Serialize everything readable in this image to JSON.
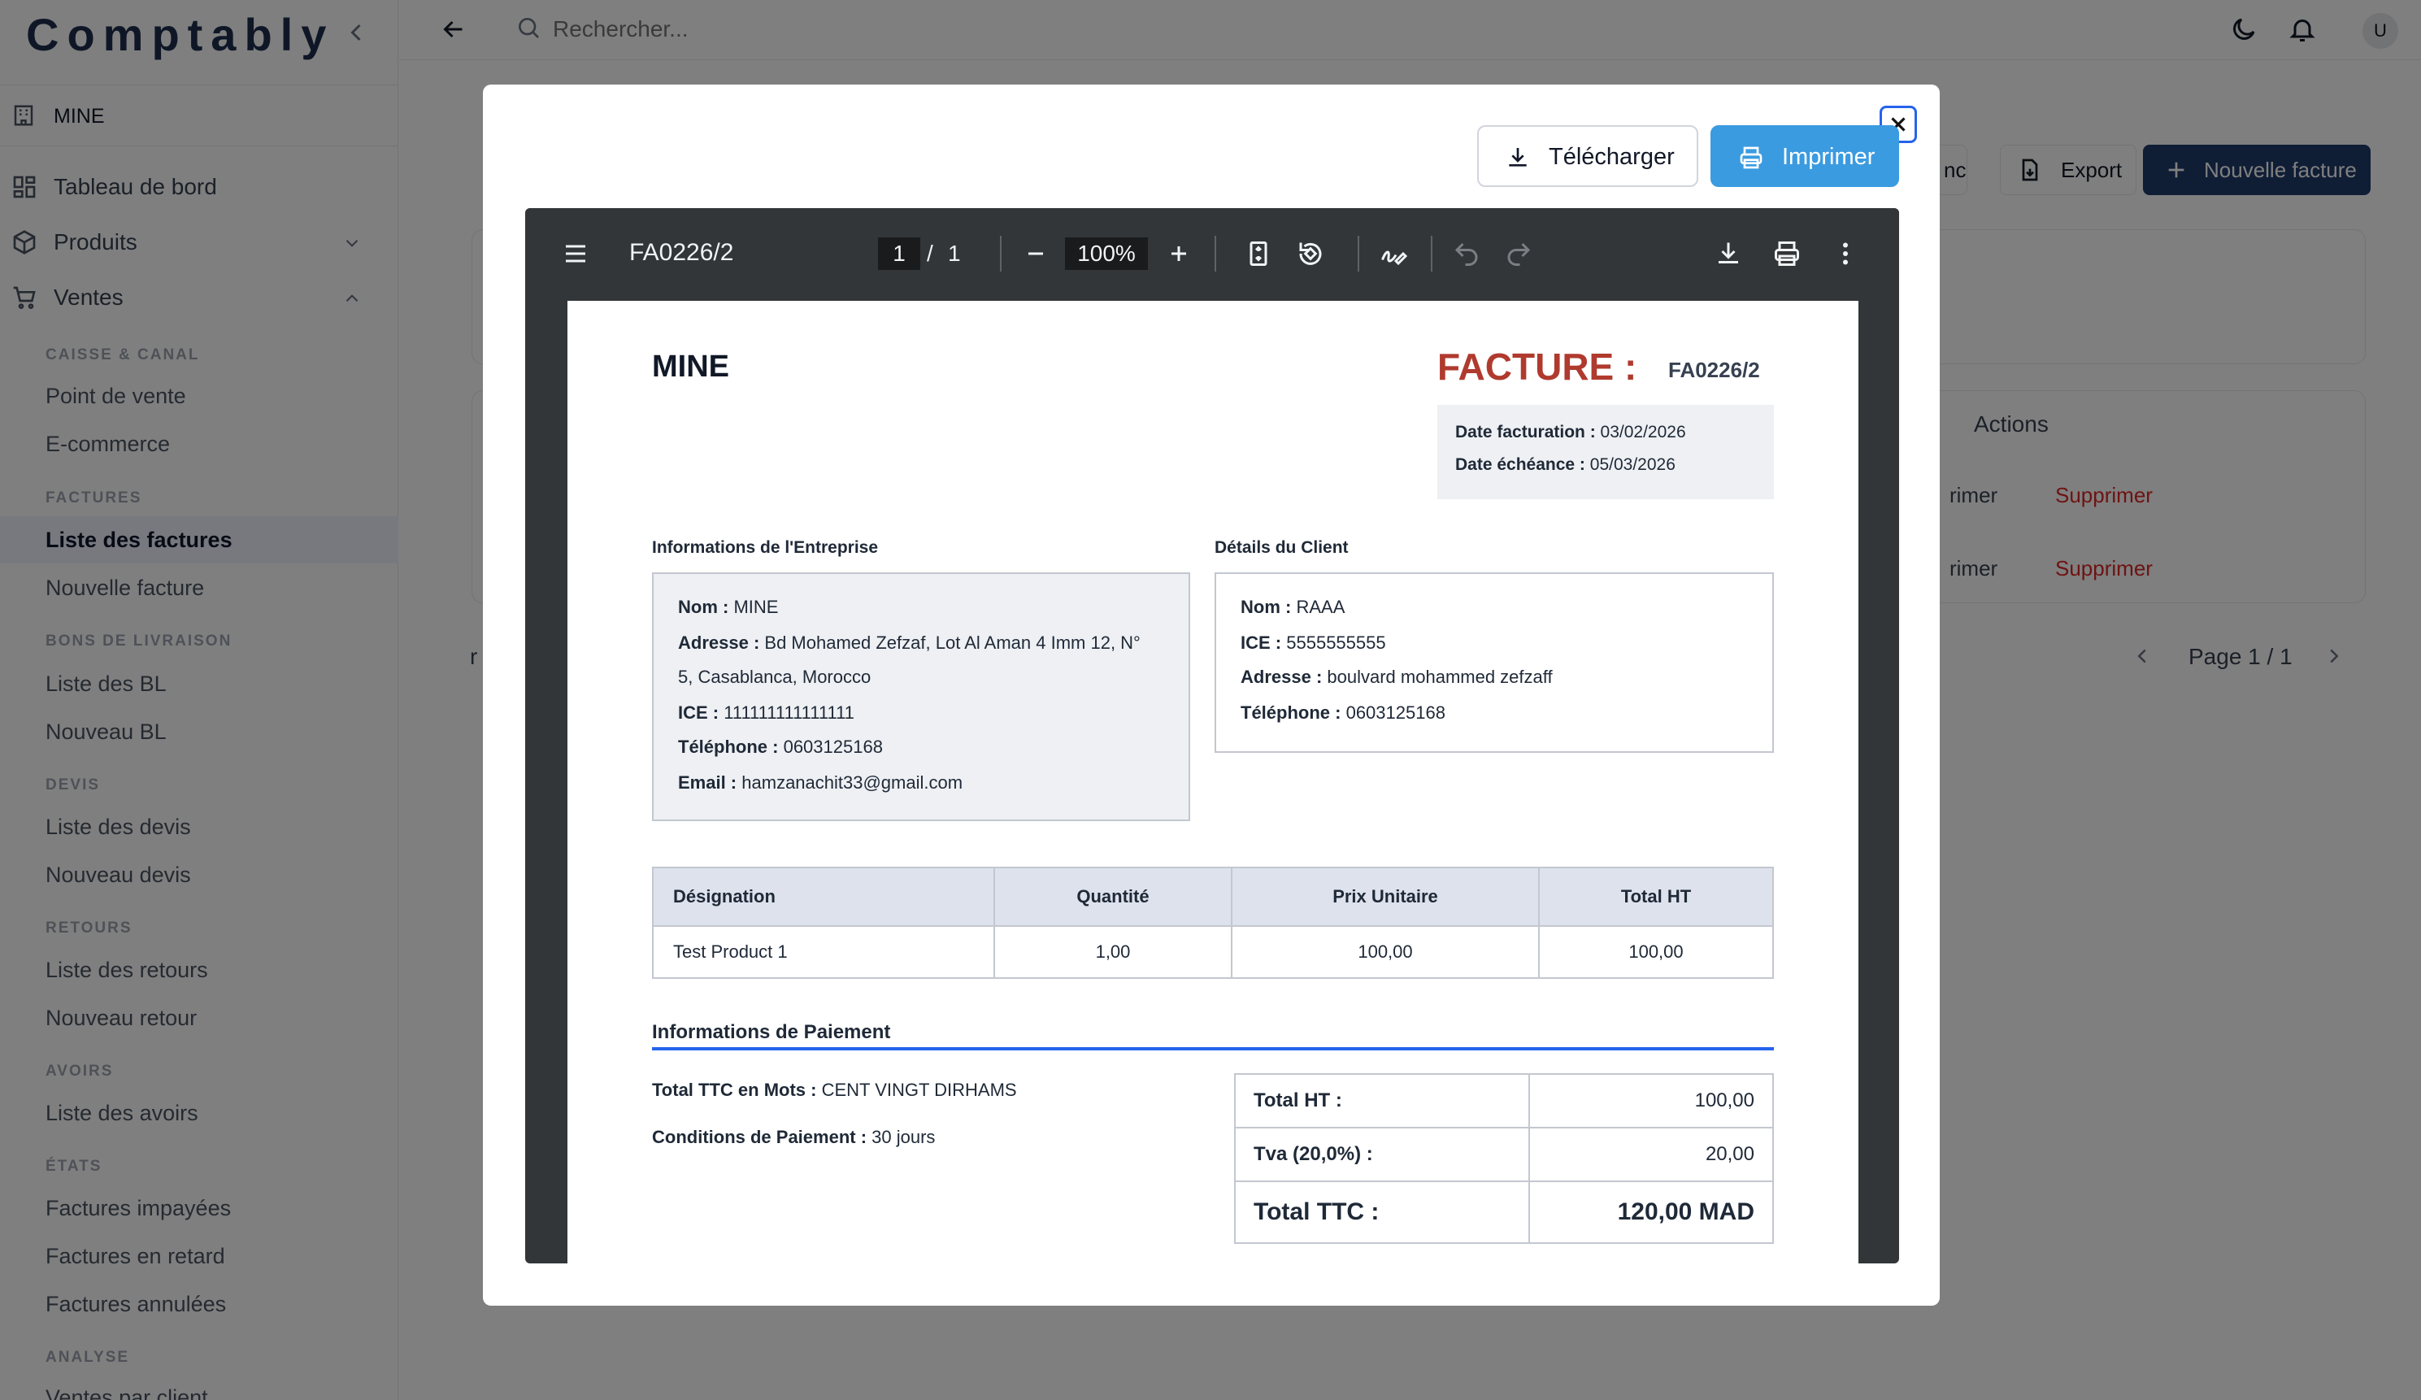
{
  "app": {
    "brand": "Comptably",
    "company": "MINE",
    "search_placeholder": "Rechercher...",
    "avatar": "U",
    "nav": {
      "dashboard": "Tableau de bord",
      "produits": "Produits",
      "ventes": "Ventes"
    },
    "sections": [
      {
        "title": "CAISSE & CANAL",
        "items": [
          "Point de vente",
          "E-commerce"
        ]
      },
      {
        "title": "FACTURES",
        "items": [
          "Liste des factures",
          "Nouvelle facture"
        ]
      },
      {
        "title": "BONS DE LIVRAISON",
        "items": [
          "Liste des BL",
          "Nouveau BL"
        ]
      },
      {
        "title": "DEVIS",
        "items": [
          "Liste des devis",
          "Nouveau devis"
        ]
      },
      {
        "title": "RETOURS",
        "items": [
          "Liste des retours",
          "Nouveau retour"
        ]
      },
      {
        "title": "AVOIRS",
        "items": [
          "Liste des avoirs"
        ]
      },
      {
        "title": "ÉTATS",
        "items": [
          "Factures impayées",
          "Factures en retard",
          "Factures annulées"
        ]
      },
      {
        "title": "ANALYSE",
        "items": [
          "Ventes par client"
        ]
      }
    ],
    "background": {
      "sync_fragment": "nc",
      "export": "Export",
      "new_invoice": "Nouvelle facture",
      "actions_header": "Actions",
      "print_fragment": "rimer",
      "delete": "Supprimer",
      "pagination": "Page 1 / 1",
      "left_fragment": "r"
    }
  },
  "modal": {
    "download_label": "Télécharger",
    "print_label": "Imprimer",
    "viewer": {
      "doc_title": "FA0226/2",
      "current_page": "1",
      "page_sep": "/",
      "total_pages": "1",
      "zoom": "100%"
    }
  },
  "invoice": {
    "company": "MINE",
    "title": "FACTURE :",
    "number": "FA0226/2",
    "dates": {
      "facturation_label": "Date facturation :",
      "facturation": "03/02/2026",
      "echeance_label": "Date échéance :",
      "echeance": "05/03/2026"
    },
    "entreprise": {
      "heading": "Informations de l'Entreprise",
      "nom_label": "Nom :",
      "nom": "MINE",
      "adresse_label": "Adresse :",
      "adresse_l1": "Bd Mohamed Zefzaf, Lot Al Aman 4 Imm 12, N°",
      "adresse_l2": "5, Casablanca, Morocco",
      "ice_label": "ICE :",
      "ice": "111111111111111",
      "tel_label": "Téléphone :",
      "tel": "0603125168",
      "email_label": "Email :",
      "email": "hamzanachit33@gmail.com"
    },
    "client": {
      "heading": "Détails du Client",
      "nom_label": "Nom :",
      "nom": "RAAA",
      "ice_label": "ICE :",
      "ice": "5555555555",
      "adresse_label": "Adresse :",
      "adresse": "boulvard mohammed zefzaff",
      "tel_label": "Téléphone :",
      "tel": "0603125168"
    },
    "table": {
      "headers": [
        "Désignation",
        "Quantité",
        "Prix Unitaire",
        "Total HT"
      ],
      "rows": [
        [
          "Test Product 1",
          "1,00",
          "100,00",
          "100,00"
        ]
      ]
    },
    "paiement": {
      "heading": "Informations de Paiement",
      "mots_label": "Total TTC en Mots :",
      "mots": "CENT VINGT DIRHAMS",
      "conditions_label": "Conditions de Paiement :",
      "conditions": "30 jours"
    },
    "totals": {
      "ht_label": "Total HT :",
      "ht": "100,00",
      "tva_label": "Tva (20,0%) :",
      "tva": "20,00",
      "ttc_label": "Total TTC :",
      "ttc": "120,00 MAD"
    }
  },
  "colors": {
    "facture_title": "#b03a2e",
    "print_button": "#3b9be0",
    "primary_dark": "#1f3b6b",
    "delete_red": "#dc2626",
    "accent_line": "#2563eb"
  }
}
